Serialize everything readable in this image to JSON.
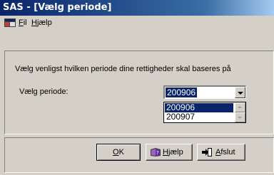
{
  "window": {
    "title": "SAS - [Vælg periode]"
  },
  "menu": {
    "items": [
      {
        "label": "Fil",
        "accel": "F"
      },
      {
        "label": "Hjælp",
        "accel": "H"
      }
    ]
  },
  "form": {
    "instruction": "Vælg venligst hvilken periode dine rettigheder skal baseres på",
    "period_label": "Vælg periode:",
    "period_value": "200906",
    "options": [
      "200906",
      "200907"
    ],
    "selected_index": 0
  },
  "buttons": {
    "ok": {
      "accel": "O",
      "rest": "K"
    },
    "help": {
      "accel": "H",
      "rest": "jælp"
    },
    "exit": {
      "accel": "A",
      "rest": "fslut"
    }
  },
  "colors": {
    "title_bar": "#0a246a",
    "selection": "#0a246a",
    "face": "#d4d0c8"
  },
  "icons": [
    "app-icon",
    "help-book-icon",
    "exit-door-icon",
    "dropdown-arrow-icon"
  ]
}
